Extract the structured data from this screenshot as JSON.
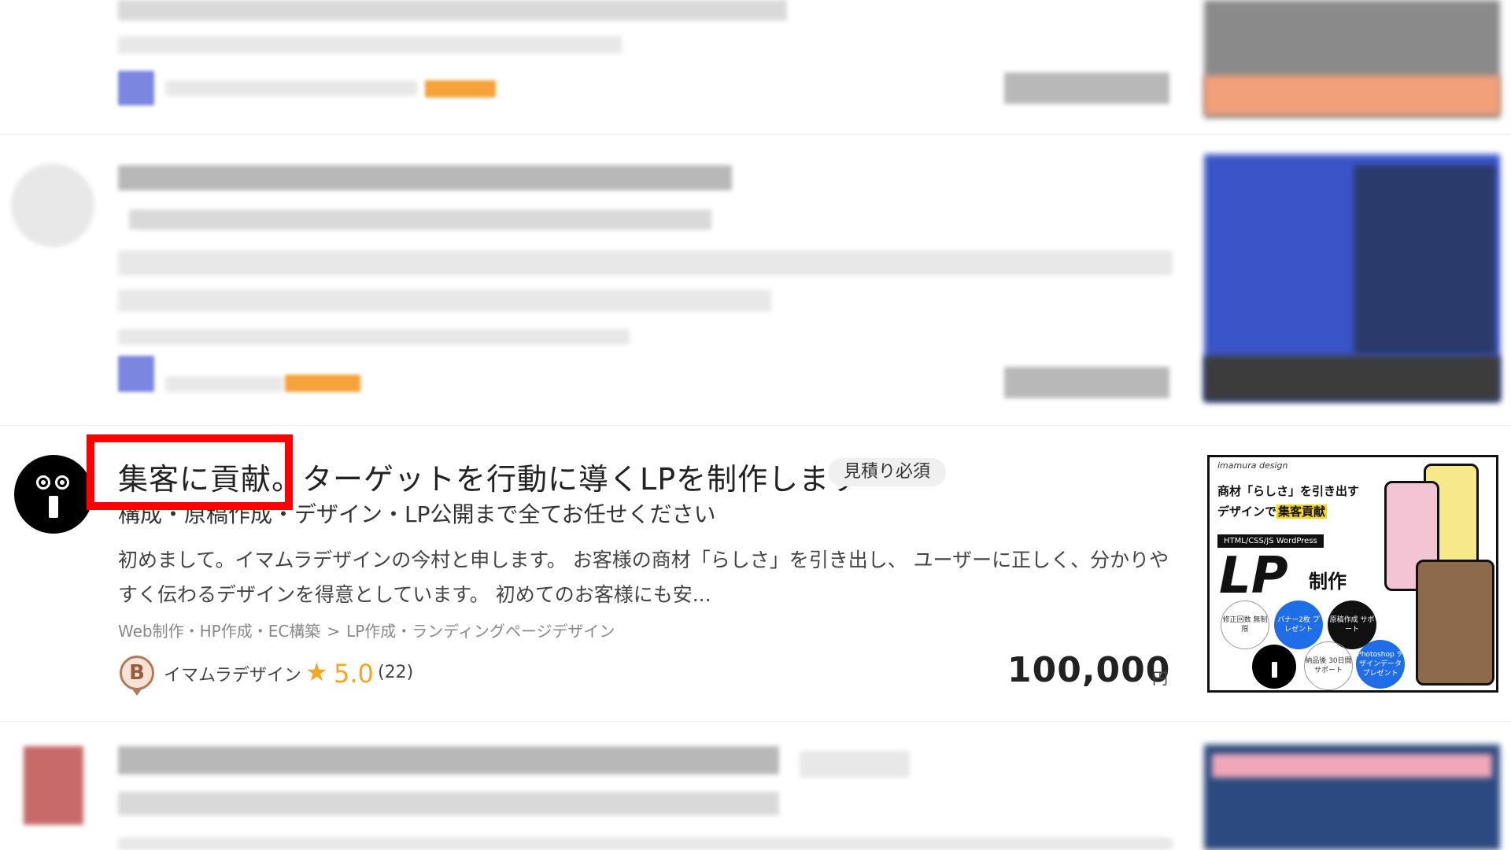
{
  "listing": {
    "title_part1": "集客に貢献。",
    "title_part2": "ターゲットを行動に導くLPを制作します",
    "badge": "見積り必須",
    "subtitle": "構成・原稿作成・デザイン・LP公開まで全てお任せください",
    "description": "初めまして。イマムラデザインの今村と申します。 お客様の商材「らしさ」を引き出し、 ユーザーに正しく、分かりやすく伝わるデザインを得意としています。 初めてのお客様にも安...",
    "category_parent": "Web制作・HP作成・EC構築",
    "category_separator": ">",
    "category_child": "LP作成・ランディングページデザイン",
    "seller_rank": "B",
    "seller_name": "イマムラデザイン",
    "rating": "5.0",
    "reviews": "(22)",
    "price": "100,000",
    "currency": "円"
  },
  "thumbnail": {
    "brand": "imamura design",
    "headline_1": "商材「らしさ」を引き出す",
    "headline_2_prefix": "デザインで",
    "headline_2_highlight": "集客貢献",
    "tech": "HTML/CSS/JS  WordPress",
    "big": "LP",
    "big_suffix": "制作",
    "badges": [
      "修正回数 無制限",
      "バナー2枚 プレゼント",
      "原稿作成 サポート",
      "納品後 30日間 サポート",
      "Photoshop デザインデータ プレゼント"
    ]
  },
  "colors": {
    "highlight": "#ff0000",
    "star": "#f5a623",
    "avatar_bg": "#000000"
  }
}
